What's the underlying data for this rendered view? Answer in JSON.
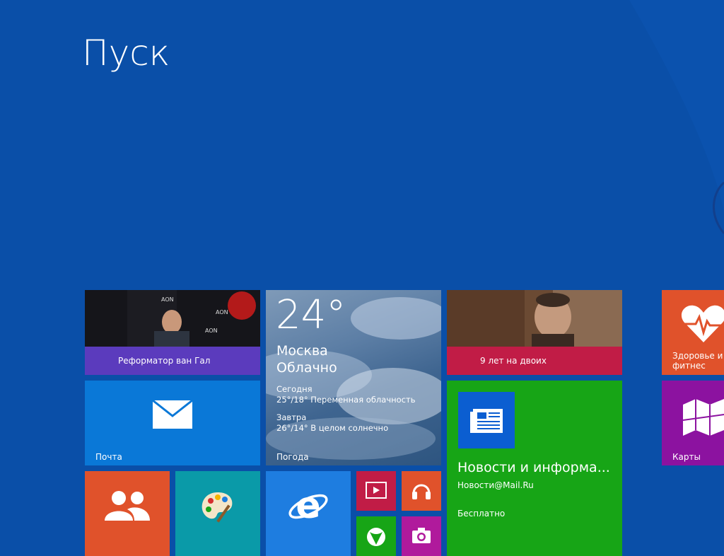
{
  "screen": {
    "title": "Пуск",
    "background_color": "#0a4fa8"
  },
  "tiles": {
    "news_vangaal": {
      "caption": "Реформатор ван Гал",
      "color": "#5b3bbd"
    },
    "news_9years": {
      "caption": "9 лет на двоих",
      "color": "#c11c46"
    },
    "weather": {
      "temperature": "24°",
      "city": "Москва",
      "condition": "Облачно",
      "today_label": "Сегодня",
      "today_forecast": "25°/18° Переменная облачность",
      "tomorrow_label": "Завтра",
      "tomorrow_forecast": "26°/14° В целом солнечно",
      "label": "Погода"
    },
    "mail": {
      "label": "Почта",
      "color": "#0a78d7",
      "icon": "envelope-icon"
    },
    "news_app": {
      "title": "Новости и информа...",
      "publisher": "Новости@Mail.Ru",
      "price": "Бесплатно",
      "color": "#17a516",
      "icon": "newspaper-icon"
    },
    "health": {
      "label": "Здоровье и фитнес",
      "color": "#e0522b",
      "icon": "heart-pulse-icon"
    },
    "maps": {
      "label": "Карты",
      "color": "#8c12a0",
      "icon": "map-icon"
    },
    "people": {
      "color": "#e0522b",
      "icon": "people-icon"
    },
    "paint": {
      "color": "#0a9aa8",
      "icon": "palette-icon"
    },
    "ie": {
      "color": "#1e7de0",
      "icon": "internet-explorer-icon"
    },
    "video": {
      "color": "#c11c46",
      "icon": "video-icon"
    },
    "music": {
      "color": "#e0522b",
      "icon": "headphones-icon"
    },
    "games": {
      "color": "#17a516",
      "icon": "xbox-icon"
    },
    "camera": {
      "color": "#b01a9c",
      "icon": "camera-icon"
    }
  }
}
